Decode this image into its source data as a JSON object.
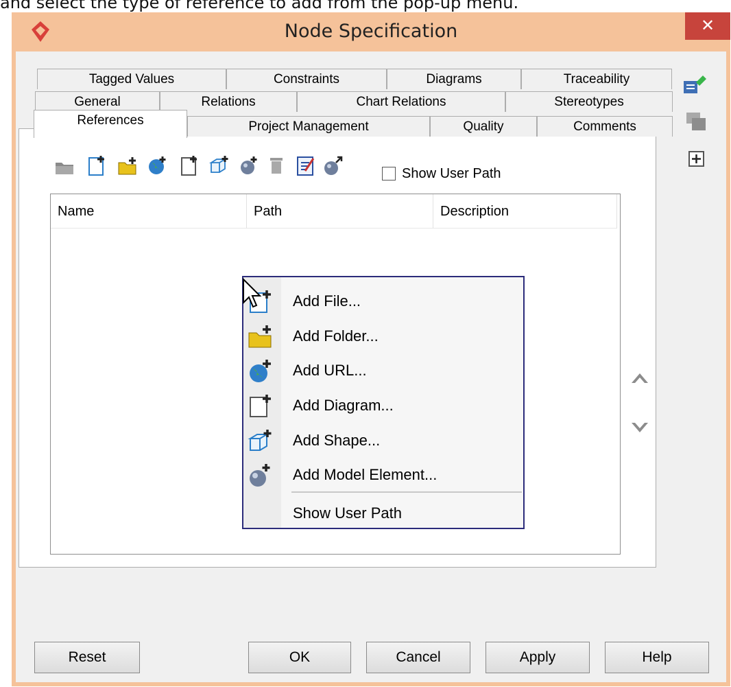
{
  "caption": "and select the type of reference to add from the pop-up menu.",
  "window": {
    "title": "Node Specification",
    "close_glyph": "✕"
  },
  "tabs": {
    "row1": [
      "Tagged Values",
      "Constraints",
      "Diagrams",
      "Traceability"
    ],
    "row2": [
      "General",
      "Relations",
      "Chart Relations",
      "Stereotypes"
    ],
    "row3": [
      "References",
      "Project Management",
      "Quality",
      "Comments"
    ],
    "selected": "References"
  },
  "toolbar": {
    "icons": [
      "open-folder-icon",
      "add-file-icon",
      "add-folder-icon",
      "add-url-icon",
      "add-diagram-icon",
      "add-shape-icon",
      "add-model-element-icon",
      "delete-icon",
      "edit-icon",
      "go-to-icon"
    ],
    "show_user_path_label": "Show User Path",
    "show_user_path_checked": false
  },
  "table": {
    "columns": [
      "Name",
      "Path",
      "Description"
    ],
    "rows": []
  },
  "context_menu": {
    "items": [
      {
        "label": "Add File...",
        "icon": "add-file-icon"
      },
      {
        "label": "Add Folder...",
        "icon": "add-folder-icon"
      },
      {
        "label": "Add URL...",
        "icon": "add-url-icon"
      },
      {
        "label": "Add Diagram...",
        "icon": "add-diagram-icon"
      },
      {
        "label": "Add Shape...",
        "icon": "add-shape-icon"
      },
      {
        "label": "Add Model Element...",
        "icon": "add-model-element-icon"
      }
    ],
    "extra_item": "Show User Path"
  },
  "side_panel": {
    "icons": [
      "pin-icon",
      "stack-icon",
      "expand-icon"
    ]
  },
  "row_controls": {
    "icons": [
      "move-up-icon",
      "move-down-icon"
    ]
  },
  "footer_buttons": {
    "reset": "Reset",
    "ok": "OK",
    "cancel": "Cancel",
    "apply": "Apply",
    "help": "Help"
  },
  "colors": {
    "title_bar": "#f5c29a",
    "close_button": "#c7443c",
    "menu_border": "#2b2b7a"
  }
}
